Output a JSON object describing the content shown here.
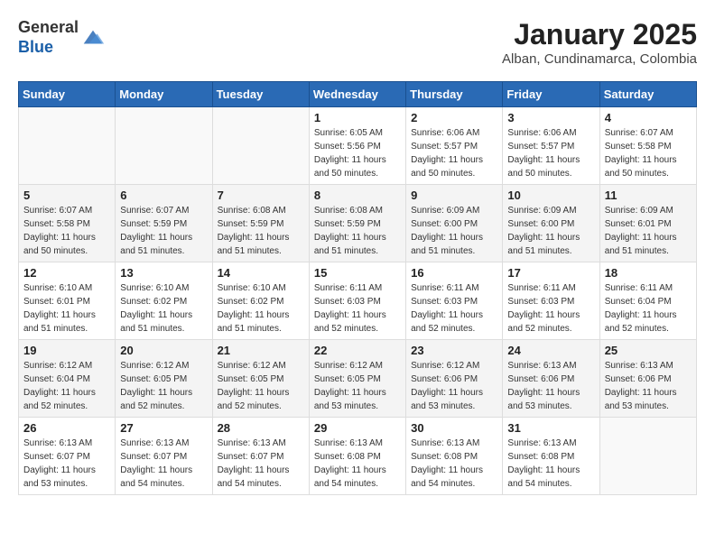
{
  "header": {
    "logo_line1": "General",
    "logo_line2": "Blue",
    "month_title": "January 2025",
    "location": "Alban, Cundinamarca, Colombia"
  },
  "weekdays": [
    "Sunday",
    "Monday",
    "Tuesday",
    "Wednesday",
    "Thursday",
    "Friday",
    "Saturday"
  ],
  "weeks": [
    [
      {
        "day": "",
        "sunrise": "",
        "sunset": "",
        "daylight": ""
      },
      {
        "day": "",
        "sunrise": "",
        "sunset": "",
        "daylight": ""
      },
      {
        "day": "",
        "sunrise": "",
        "sunset": "",
        "daylight": ""
      },
      {
        "day": "1",
        "sunrise": "Sunrise: 6:05 AM",
        "sunset": "Sunset: 5:56 PM",
        "daylight": "Daylight: 11 hours and 50 minutes."
      },
      {
        "day": "2",
        "sunrise": "Sunrise: 6:06 AM",
        "sunset": "Sunset: 5:57 PM",
        "daylight": "Daylight: 11 hours and 50 minutes."
      },
      {
        "day": "3",
        "sunrise": "Sunrise: 6:06 AM",
        "sunset": "Sunset: 5:57 PM",
        "daylight": "Daylight: 11 hours and 50 minutes."
      },
      {
        "day": "4",
        "sunrise": "Sunrise: 6:07 AM",
        "sunset": "Sunset: 5:58 PM",
        "daylight": "Daylight: 11 hours and 50 minutes."
      }
    ],
    [
      {
        "day": "5",
        "sunrise": "Sunrise: 6:07 AM",
        "sunset": "Sunset: 5:58 PM",
        "daylight": "Daylight: 11 hours and 50 minutes."
      },
      {
        "day": "6",
        "sunrise": "Sunrise: 6:07 AM",
        "sunset": "Sunset: 5:59 PM",
        "daylight": "Daylight: 11 hours and 51 minutes."
      },
      {
        "day": "7",
        "sunrise": "Sunrise: 6:08 AM",
        "sunset": "Sunset: 5:59 PM",
        "daylight": "Daylight: 11 hours and 51 minutes."
      },
      {
        "day": "8",
        "sunrise": "Sunrise: 6:08 AM",
        "sunset": "Sunset: 5:59 PM",
        "daylight": "Daylight: 11 hours and 51 minutes."
      },
      {
        "day": "9",
        "sunrise": "Sunrise: 6:09 AM",
        "sunset": "Sunset: 6:00 PM",
        "daylight": "Daylight: 11 hours and 51 minutes."
      },
      {
        "day": "10",
        "sunrise": "Sunrise: 6:09 AM",
        "sunset": "Sunset: 6:00 PM",
        "daylight": "Daylight: 11 hours and 51 minutes."
      },
      {
        "day": "11",
        "sunrise": "Sunrise: 6:09 AM",
        "sunset": "Sunset: 6:01 PM",
        "daylight": "Daylight: 11 hours and 51 minutes."
      }
    ],
    [
      {
        "day": "12",
        "sunrise": "Sunrise: 6:10 AM",
        "sunset": "Sunset: 6:01 PM",
        "daylight": "Daylight: 11 hours and 51 minutes."
      },
      {
        "day": "13",
        "sunrise": "Sunrise: 6:10 AM",
        "sunset": "Sunset: 6:02 PM",
        "daylight": "Daylight: 11 hours and 51 minutes."
      },
      {
        "day": "14",
        "sunrise": "Sunrise: 6:10 AM",
        "sunset": "Sunset: 6:02 PM",
        "daylight": "Daylight: 11 hours and 51 minutes."
      },
      {
        "day": "15",
        "sunrise": "Sunrise: 6:11 AM",
        "sunset": "Sunset: 6:03 PM",
        "daylight": "Daylight: 11 hours and 52 minutes."
      },
      {
        "day": "16",
        "sunrise": "Sunrise: 6:11 AM",
        "sunset": "Sunset: 6:03 PM",
        "daylight": "Daylight: 11 hours and 52 minutes."
      },
      {
        "day": "17",
        "sunrise": "Sunrise: 6:11 AM",
        "sunset": "Sunset: 6:03 PM",
        "daylight": "Daylight: 11 hours and 52 minutes."
      },
      {
        "day": "18",
        "sunrise": "Sunrise: 6:11 AM",
        "sunset": "Sunset: 6:04 PM",
        "daylight": "Daylight: 11 hours and 52 minutes."
      }
    ],
    [
      {
        "day": "19",
        "sunrise": "Sunrise: 6:12 AM",
        "sunset": "Sunset: 6:04 PM",
        "daylight": "Daylight: 11 hours and 52 minutes."
      },
      {
        "day": "20",
        "sunrise": "Sunrise: 6:12 AM",
        "sunset": "Sunset: 6:05 PM",
        "daylight": "Daylight: 11 hours and 52 minutes."
      },
      {
        "day": "21",
        "sunrise": "Sunrise: 6:12 AM",
        "sunset": "Sunset: 6:05 PM",
        "daylight": "Daylight: 11 hours and 52 minutes."
      },
      {
        "day": "22",
        "sunrise": "Sunrise: 6:12 AM",
        "sunset": "Sunset: 6:05 PM",
        "daylight": "Daylight: 11 hours and 53 minutes."
      },
      {
        "day": "23",
        "sunrise": "Sunrise: 6:12 AM",
        "sunset": "Sunset: 6:06 PM",
        "daylight": "Daylight: 11 hours and 53 minutes."
      },
      {
        "day": "24",
        "sunrise": "Sunrise: 6:13 AM",
        "sunset": "Sunset: 6:06 PM",
        "daylight": "Daylight: 11 hours and 53 minutes."
      },
      {
        "day": "25",
        "sunrise": "Sunrise: 6:13 AM",
        "sunset": "Sunset: 6:06 PM",
        "daylight": "Daylight: 11 hours and 53 minutes."
      }
    ],
    [
      {
        "day": "26",
        "sunrise": "Sunrise: 6:13 AM",
        "sunset": "Sunset: 6:07 PM",
        "daylight": "Daylight: 11 hours and 53 minutes."
      },
      {
        "day": "27",
        "sunrise": "Sunrise: 6:13 AM",
        "sunset": "Sunset: 6:07 PM",
        "daylight": "Daylight: 11 hours and 54 minutes."
      },
      {
        "day": "28",
        "sunrise": "Sunrise: 6:13 AM",
        "sunset": "Sunset: 6:07 PM",
        "daylight": "Daylight: 11 hours and 54 minutes."
      },
      {
        "day": "29",
        "sunrise": "Sunrise: 6:13 AM",
        "sunset": "Sunset: 6:08 PM",
        "daylight": "Daylight: 11 hours and 54 minutes."
      },
      {
        "day": "30",
        "sunrise": "Sunrise: 6:13 AM",
        "sunset": "Sunset: 6:08 PM",
        "daylight": "Daylight: 11 hours and 54 minutes."
      },
      {
        "day": "31",
        "sunrise": "Sunrise: 6:13 AM",
        "sunset": "Sunset: 6:08 PM",
        "daylight": "Daylight: 11 hours and 54 minutes."
      },
      {
        "day": "",
        "sunrise": "",
        "sunset": "",
        "daylight": ""
      }
    ]
  ]
}
